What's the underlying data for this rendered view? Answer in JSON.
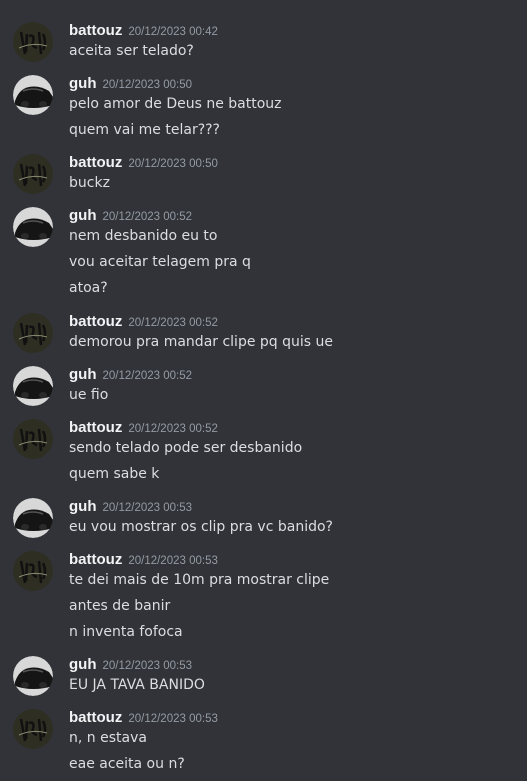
{
  "messages": [
    {
      "author": "battouz",
      "timestamp": "20/12/2023 00:42",
      "lines": [
        "aceita ser telado?"
      ]
    },
    {
      "author": "guh",
      "timestamp": "20/12/2023 00:50",
      "lines": [
        "pelo amor de Deus ne battouz",
        "quem vai me telar???"
      ]
    },
    {
      "author": "battouz",
      "timestamp": "20/12/2023 00:50",
      "lines": [
        "buckz"
      ]
    },
    {
      "author": "guh",
      "timestamp": "20/12/2023 00:52",
      "lines": [
        "nem desbanido eu to",
        "vou aceitar telagem pra q",
        "atoa?"
      ]
    },
    {
      "author": "battouz",
      "timestamp": "20/12/2023 00:52",
      "lines": [
        "demorou pra mandar clipe pq quis ue"
      ]
    },
    {
      "author": "guh",
      "timestamp": "20/12/2023 00:52",
      "lines": [
        "ue fio"
      ]
    },
    {
      "author": "battouz",
      "timestamp": "20/12/2023 00:52",
      "lines": [
        "sendo telado pode ser desbanido",
        "quem sabe k"
      ]
    },
    {
      "author": "guh",
      "timestamp": "20/12/2023 00:53",
      "lines": [
        "eu vou mostrar os clip pra vc banido?"
      ]
    },
    {
      "author": "battouz",
      "timestamp": "20/12/2023 00:53",
      "lines": [
        "te dei mais de 10m pra mostrar clipe",
        "antes de banir",
        "n inventa fofoca"
      ]
    },
    {
      "author": "guh",
      "timestamp": "20/12/2023 00:53",
      "lines": [
        "EU JA TAVA BANIDO"
      ]
    },
    {
      "author": "battouz",
      "timestamp": "20/12/2023 00:53",
      "lines": [
        "n, n estava",
        "eae aceita ou n?"
      ]
    }
  ],
  "avatars": {
    "battouz": "battouz-avatar",
    "guh": "guh-car-avatar"
  },
  "colors": {
    "background": "#313338",
    "username": "#f2f3f5",
    "timestamp": "#949ba4",
    "text": "#dbdee1"
  }
}
